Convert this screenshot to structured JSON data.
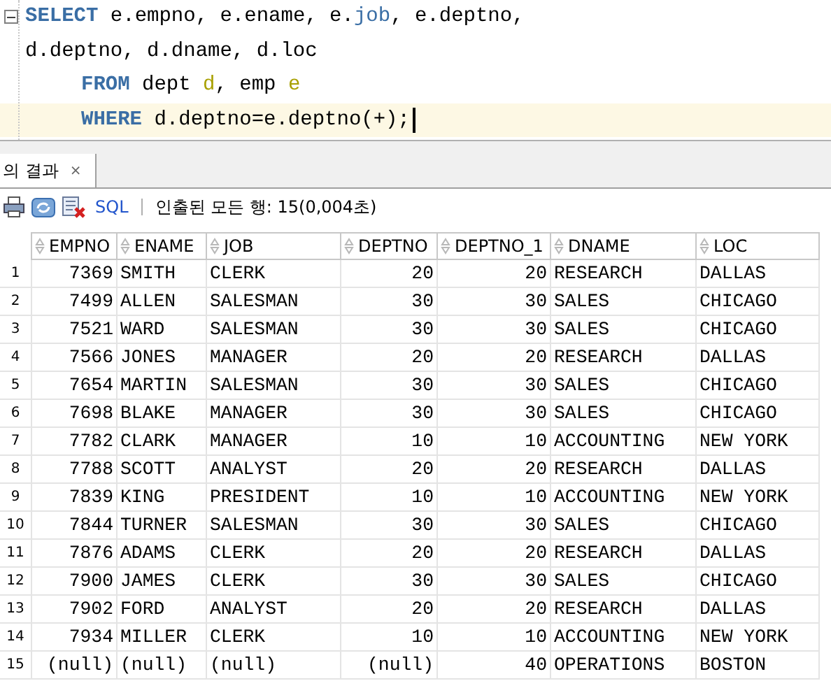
{
  "editor": {
    "lines": [
      {
        "indent": false,
        "current": false,
        "fold": true,
        "tokens": [
          {
            "text": "SELECT",
            "kind": "keyword"
          },
          {
            "text": " e.empno, e.ename, e.",
            "kind": "plain"
          },
          {
            "text": "job",
            "kind": "keyword2"
          },
          {
            "text": ", e.deptno,",
            "kind": "plain"
          }
        ]
      },
      {
        "indent": false,
        "current": false,
        "fold": false,
        "tokens": [
          {
            "text": "d.deptno, d.dname, d.loc",
            "kind": "plain"
          }
        ]
      },
      {
        "indent": true,
        "current": false,
        "fold": false,
        "tokens": [
          {
            "text": "FROM",
            "kind": "keyword"
          },
          {
            "text": " dept ",
            "kind": "plain"
          },
          {
            "text": "d",
            "kind": "alias"
          },
          {
            "text": ", emp ",
            "kind": "plain"
          },
          {
            "text": "e",
            "kind": "alias"
          }
        ]
      },
      {
        "indent": true,
        "current": true,
        "fold": false,
        "tokens": [
          {
            "text": "WHERE",
            "kind": "keyword"
          },
          {
            "text": " d.deptno=e.deptno(+);",
            "kind": "plain"
          }
        ]
      }
    ]
  },
  "results_tab": {
    "label": "의 결과",
    "close": "×",
    "selected": true
  },
  "toolbar": {
    "sql_label": "SQL",
    "status": "인출된 모든 행: 15(0,004초)"
  },
  "table": {
    "columns": [
      {
        "name": "EMPNO",
        "kind": "number"
      },
      {
        "name": "ENAME",
        "kind": "text"
      },
      {
        "name": "JOB",
        "kind": "text"
      },
      {
        "name": "DEPTNO",
        "kind": "number"
      },
      {
        "name": "DEPTNO_1",
        "kind": "number"
      },
      {
        "name": "DNAME",
        "kind": "text"
      },
      {
        "name": "LOC",
        "kind": "text"
      }
    ],
    "rows": [
      {
        "num": "1",
        "cells": [
          "7369",
          "SMITH",
          "CLERK",
          "20",
          "20",
          "RESEARCH",
          "DALLAS"
        ]
      },
      {
        "num": "2",
        "cells": [
          "7499",
          "ALLEN",
          "SALESMAN",
          "30",
          "30",
          "SALES",
          "CHICAGO"
        ]
      },
      {
        "num": "3",
        "cells": [
          "7521",
          "WARD",
          "SALESMAN",
          "30",
          "30",
          "SALES",
          "CHICAGO"
        ]
      },
      {
        "num": "4",
        "cells": [
          "7566",
          "JONES",
          "MANAGER",
          "20",
          "20",
          "RESEARCH",
          "DALLAS"
        ]
      },
      {
        "num": "5",
        "cells": [
          "7654",
          "MARTIN",
          "SALESMAN",
          "30",
          "30",
          "SALES",
          "CHICAGO"
        ]
      },
      {
        "num": "6",
        "cells": [
          "7698",
          "BLAKE",
          "MANAGER",
          "30",
          "30",
          "SALES",
          "CHICAGO"
        ]
      },
      {
        "num": "7",
        "cells": [
          "7782",
          "CLARK",
          "MANAGER",
          "10",
          "10",
          "ACCOUNTING",
          "NEW YORK"
        ]
      },
      {
        "num": "8",
        "cells": [
          "7788",
          "SCOTT",
          "ANALYST",
          "20",
          "20",
          "RESEARCH",
          "DALLAS"
        ]
      },
      {
        "num": "9",
        "cells": [
          "7839",
          "KING",
          "PRESIDENT",
          "10",
          "10",
          "ACCOUNTING",
          "NEW YORK"
        ]
      },
      {
        "num": "10",
        "cells": [
          "7844",
          "TURNER",
          "SALESMAN",
          "30",
          "30",
          "SALES",
          "CHICAGO"
        ]
      },
      {
        "num": "11",
        "cells": [
          "7876",
          "ADAMS",
          "CLERK",
          "20",
          "20",
          "RESEARCH",
          "DALLAS"
        ]
      },
      {
        "num": "12",
        "cells": [
          "7900",
          "JAMES",
          "CLERK",
          "30",
          "30",
          "SALES",
          "CHICAGO"
        ]
      },
      {
        "num": "13",
        "cells": [
          "7902",
          "FORD",
          "ANALYST",
          "20",
          "20",
          "RESEARCH",
          "DALLAS"
        ]
      },
      {
        "num": "14",
        "cells": [
          "7934",
          "MILLER",
          "CLERK",
          "10",
          "10",
          "ACCOUNTING",
          "NEW YORK"
        ]
      },
      {
        "num": "15",
        "cells": [
          "(null)",
          "(null)",
          "(null)",
          "(null)",
          "40",
          "OPERATIONS",
          "BOSTON"
        ]
      }
    ]
  }
}
